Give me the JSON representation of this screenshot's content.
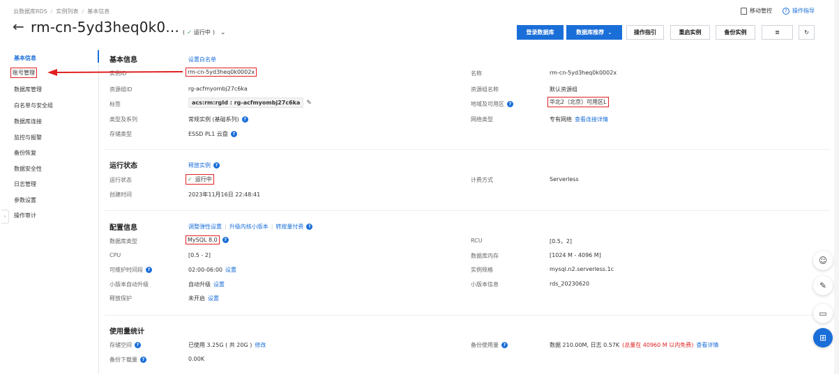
{
  "breadcrumb": [
    "云数据库RDS",
    "实例列表",
    "基本信息"
  ],
  "top_right": {
    "mobile": "移动管控",
    "guide": "操作指导"
  },
  "header": {
    "title": "rm-cn-5yd3heq0k0...",
    "status": "运行中",
    "buttons": {
      "login": "登录数据库",
      "recommend": "数据库推荐",
      "op_guide": "操作指引",
      "restart": "重启实例",
      "backup": "备份实例"
    }
  },
  "sidebar": {
    "items": [
      {
        "label": "基本信息"
      },
      {
        "label": "账号管理"
      },
      {
        "label": "数据库管理"
      },
      {
        "label": "白名单与安全组"
      },
      {
        "label": "数据库连接"
      },
      {
        "label": "监控与报警"
      },
      {
        "label": "备份恢复"
      },
      {
        "label": "数据安全性"
      },
      {
        "label": "日志管理"
      },
      {
        "label": "参数设置"
      },
      {
        "label": "操作审计"
      }
    ]
  },
  "basic": {
    "title": "基本信息",
    "link": "设置白名单",
    "instance_id_label": "实例ID",
    "instance_id": "rm-cn-5yd3heq0k0002x",
    "name_label": "名称",
    "name": "rm-cn-5yd3heq0k0002x",
    "rg_id_label": "资源组ID",
    "rg_id": "rg-acfmyombj27c6ka",
    "rg_name_label": "资源组名称",
    "rg_name": "默认资源组",
    "tag_label": "标签",
    "tag": "acs:rm:rgId : rg-acfmyombj27c6ka",
    "region_label": "地域及可用区",
    "region": "华北2（北京）可用区L",
    "type_label": "类型及系列",
    "type": "常规实例 (基础系列)",
    "network_label": "网络类型",
    "network": "专有网络",
    "network_link": "查看连接详情",
    "storage_label": "存储类型",
    "storage": "ESSD PL1 云盘"
  },
  "run": {
    "title": "运行状态",
    "link": "释放实例",
    "state_label": "运行状态",
    "state": "运行中",
    "billing_label": "计费方式",
    "billing": "Serverless",
    "created_label": "创建时间",
    "created": "2023年11月16日 22:48:41"
  },
  "config": {
    "title": "配置信息",
    "link1": "调整弹性设置",
    "link2": "升级内核小版本",
    "link3": "转按量付费",
    "dbtype_label": "数据库类型",
    "dbtype": "MySQL  8.0",
    "rcu_label": "RCU",
    "rcu": "[0.5，2]",
    "cpu_label": "CPU",
    "cpu": "[0.5 - 2]",
    "mem_label": "数据库内存",
    "mem": "[1024 M - 4096 M]",
    "maint_label": "可维护时间段",
    "maint": "02:00-06:00",
    "set": "设置",
    "spec_label": "实例规格",
    "spec": "mysql.n2.serverless.1c",
    "upgrade_label": "小版本自动升级",
    "upgrade": "自动升级",
    "minor_label": "小版本信息",
    "minor": "rds_20230620",
    "protect_label": "释放保护",
    "protect": "未开启"
  },
  "usage": {
    "title": "使用量统计",
    "space_label": "存储空间",
    "space": "已使用 3.25G ( 共 20G )",
    "modify": "修改",
    "backup_label": "备份使用量",
    "backup": "数据 210.00M, 日志 0.57K",
    "backup_free": "(总量在 40960 M 以内免费)",
    "backup_link": "查看详情",
    "download_label": "备份下载量",
    "download": "0.00K"
  },
  "icons": [
    "back-arrow-icon",
    "check-icon",
    "chevron-down-icon",
    "help-icon",
    "pencil-icon",
    "mobile-icon",
    "robot-icon",
    "edit-icon",
    "chat-icon",
    "apps-icon"
  ],
  "colors": {
    "accent": "#1a6ed8",
    "annotation": "#e02020",
    "success": "#2ea04f"
  }
}
